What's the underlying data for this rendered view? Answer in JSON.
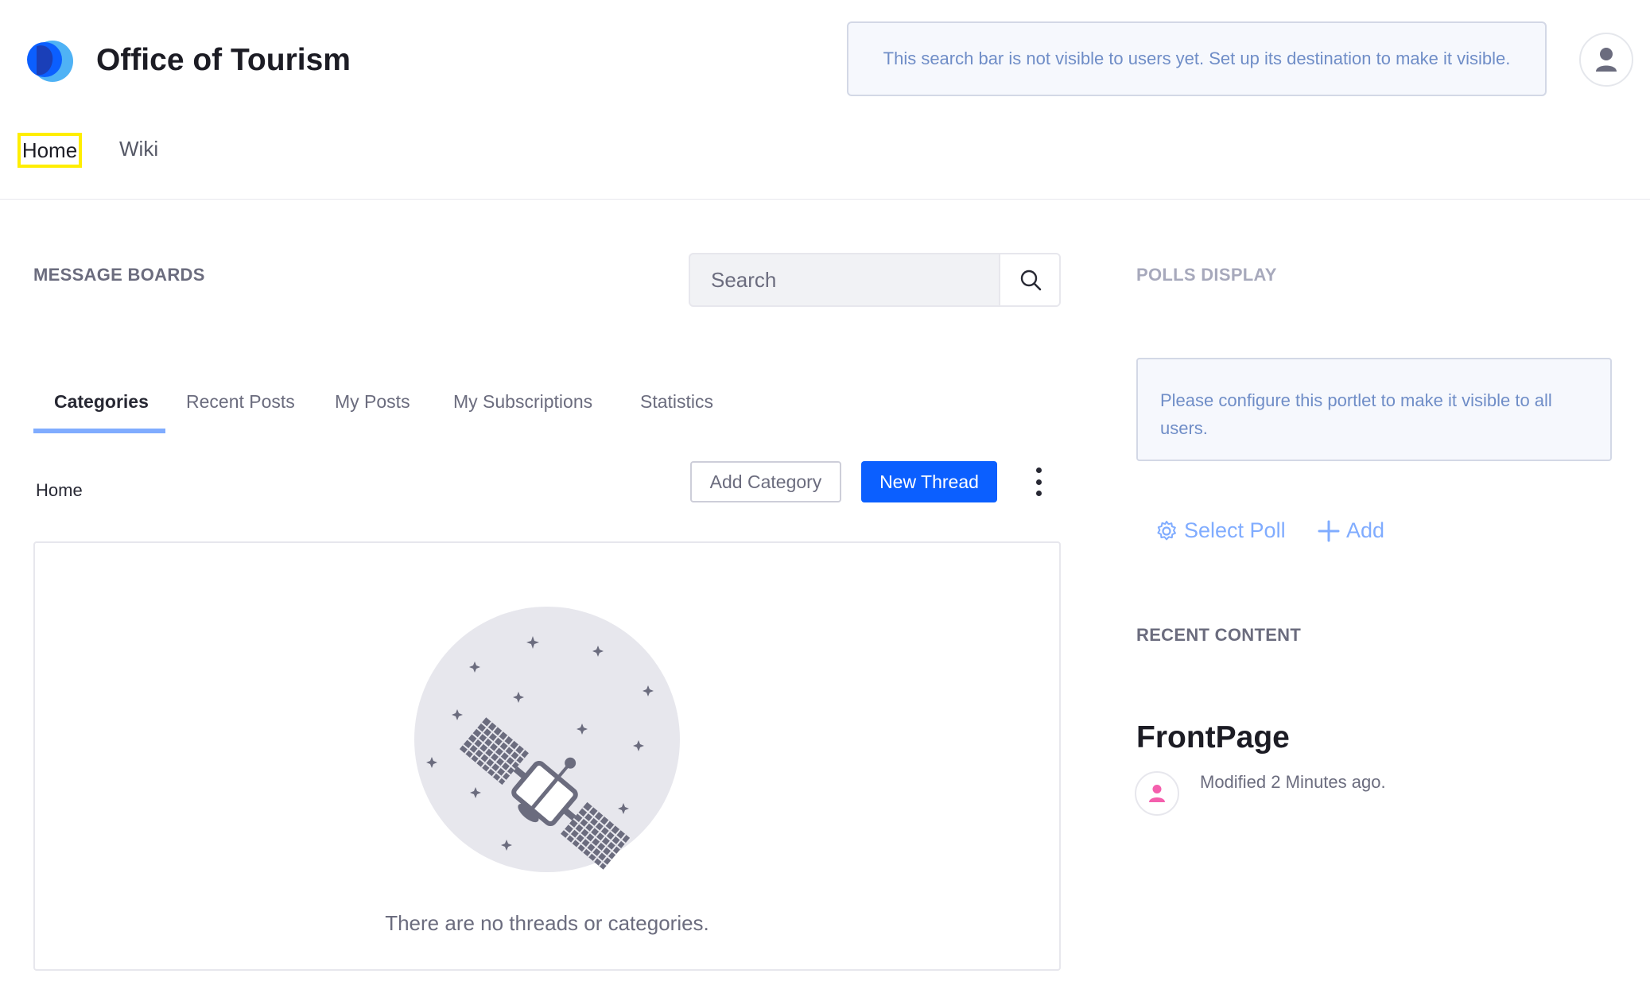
{
  "header": {
    "site_title": "Office of Tourism",
    "search_notice": "This search bar is not visible to users yet. Set up its destination to make it visible.",
    "logo_colors": [
      "#0b5fff",
      "#1c4fc7",
      "#4fb2f5"
    ]
  },
  "nav": {
    "items": [
      {
        "label": "Home",
        "active": true
      },
      {
        "label": "Wiki",
        "active": false
      }
    ]
  },
  "message_boards": {
    "title": "MESSAGE BOARDS",
    "search": {
      "placeholder": "Search",
      "icon": "search-icon"
    },
    "tabs": [
      {
        "label": "Categories",
        "active": true
      },
      {
        "label": "Recent Posts",
        "active": false
      },
      {
        "label": "My Posts",
        "active": false
      },
      {
        "label": "My Subscriptions",
        "active": false
      },
      {
        "label": "Statistics",
        "active": false
      }
    ],
    "breadcrumb": "Home",
    "add_category_label": "Add Category",
    "new_thread_label": "New Thread",
    "empty_message": "There are no threads or categories.",
    "primary_color": "#0b5fff"
  },
  "polls": {
    "title": "POLLS DISPLAY",
    "notice": "Please configure this portlet to make it visible to all users.",
    "select_label": "Select Poll",
    "add_label": "Add"
  },
  "recent_content": {
    "title": "RECENT CONTENT",
    "item_title": "FrontPage",
    "item_meta": "Modified 2 Minutes ago."
  }
}
